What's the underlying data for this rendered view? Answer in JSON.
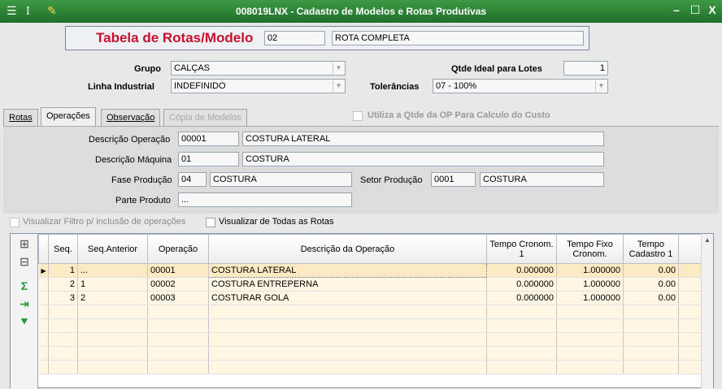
{
  "window": {
    "title": "008019LNX - Cadastro de Modelos e Rotas Produtivas",
    "minimize": "–",
    "maximize": "☐",
    "close": "X"
  },
  "header": {
    "label": "Tabela de Rotas/Modelo",
    "code": "02",
    "name": "ROTA COMPLETA"
  },
  "form": {
    "grupo_label": "Grupo",
    "grupo_value": "CALÇAS",
    "linha_label": "Linha Industrial",
    "linha_value": "INDEFINIDO",
    "qtde_label": "Qtde Ideal para Lotes",
    "qtde_value": "1",
    "tolerancias_label": "Tolerâncias",
    "tolerancias_value": "07 - 100%"
  },
  "tabs": {
    "rotas": "Rotas",
    "operacoes": "Operações",
    "observacao": "Observação",
    "copia": "Cópia de Modelos"
  },
  "utiliza_label": "Utiliza a Qtde da OP Para Calculo do Custo",
  "operacao": {
    "desc_op_label": "Descrição Operação",
    "desc_op_code": "00001",
    "desc_op_name": "COSTURA LATERAL",
    "desc_maq_label": "Descrição Máquina",
    "desc_maq_code": "01",
    "desc_maq_name": "COSTURA",
    "fase_label": "Fase Produção",
    "fase_code": "04",
    "fase_name": "COSTURA",
    "setor_label": "Setor Produção",
    "setor_code": "0001",
    "setor_name": "COSTURA",
    "parte_label": "Parte Produto",
    "parte_value": "..."
  },
  "filtros": {
    "visualizar_filtro": "Visualizar Filtro p/ inclusão de operações",
    "visualizar_todas": "Visualizar de Todas as Rotas"
  },
  "grid": {
    "headers": {
      "seq": "Seq.",
      "seq_anterior": "Seq.Anterior",
      "operacao": "Operação",
      "descricao": "Descrição da Operação",
      "tempo_cronom": "Tempo Cronom. 1",
      "tempo_fixo": "Tempo Fixo Cronom.",
      "tempo_cadastro": "Tempo Cadastro 1"
    },
    "rows": [
      {
        "seq": "1",
        "seq_anterior": "...",
        "operacao": "00001",
        "descricao": "COSTURA LATERAL",
        "tempo_cronom": "0.000000",
        "tempo_fixo": "1.000000",
        "tempo_cadastro": "0.00"
      },
      {
        "seq": "2",
        "seq_anterior": "1",
        "operacao": "00002",
        "descricao": "COSTURA ENTREPERNA",
        "tempo_cronom": "0.000000",
        "tempo_fixo": "1.000000",
        "tempo_cadastro": "0.00"
      },
      {
        "seq": "3",
        "seq_anterior": "2",
        "operacao": "00003",
        "descricao": "COSTURAR GOLA",
        "tempo_cronom": "0.000000",
        "tempo_fixo": "1.000000",
        "tempo_cadastro": "0.00"
      }
    ]
  },
  "colors": {
    "titlebar": "#2b8a35",
    "accent_title": "#c8102e",
    "grid_row": "#fff6e3"
  }
}
